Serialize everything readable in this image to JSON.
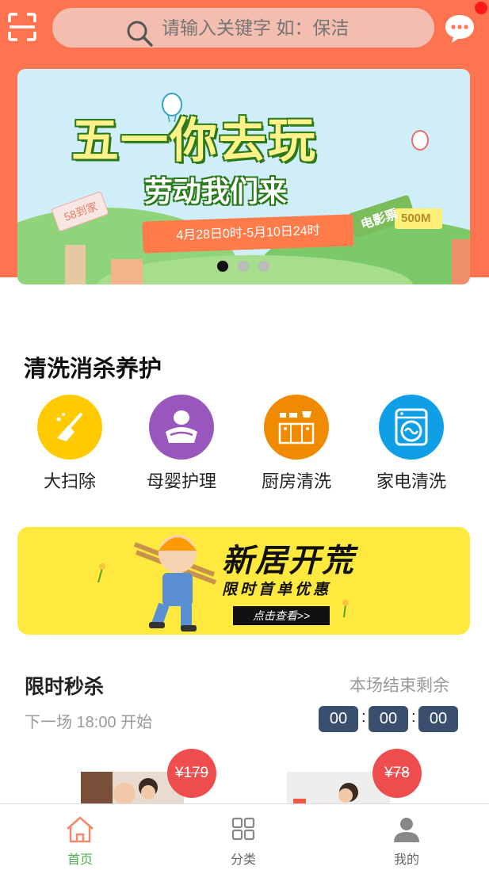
{
  "header": {
    "search_placeholder": "请输入关键字 如：保洁",
    "accent": "#ff7450"
  },
  "banner": {
    "title": "五一你去玩",
    "subtitle": "劳动我们来",
    "date_range": "4月28日0时-5月10日24时",
    "tag_left": "58到家",
    "tag_right": "电影票",
    "tag_size": "500M"
  },
  "services": {
    "title": "清洗消杀养护",
    "items": [
      {
        "label": "大扫除",
        "icon": "broom-icon",
        "color": "#ffcb00"
      },
      {
        "label": "母婴护理",
        "icon": "baby-icon",
        "color": "#9956bd"
      },
      {
        "label": "厨房清洗",
        "icon": "kitchen-icon",
        "color": "#f08a00"
      },
      {
        "label": "家电清洗",
        "icon": "washing-machine-icon",
        "color": "#0e9fe6"
      }
    ]
  },
  "promo": {
    "title": "新居开荒",
    "subtitle": "限时首单优惠",
    "button": "点击查看>>"
  },
  "flash_sale": {
    "title": "限时秒杀",
    "end_label": "本场结束剩余",
    "next_label": "下一场 18:00 开始",
    "hours": "00",
    "minutes": "00",
    "seconds": "00",
    "products": [
      {
        "price": "¥179"
      },
      {
        "price": "¥78"
      }
    ]
  },
  "tabbar": {
    "items": [
      {
        "label": "首页",
        "icon": "home-icon",
        "active": true
      },
      {
        "label": "分类",
        "icon": "grid-icon",
        "active": false
      },
      {
        "label": "我的",
        "icon": "user-icon",
        "active": false
      }
    ],
    "active_color": "#4caf50"
  }
}
